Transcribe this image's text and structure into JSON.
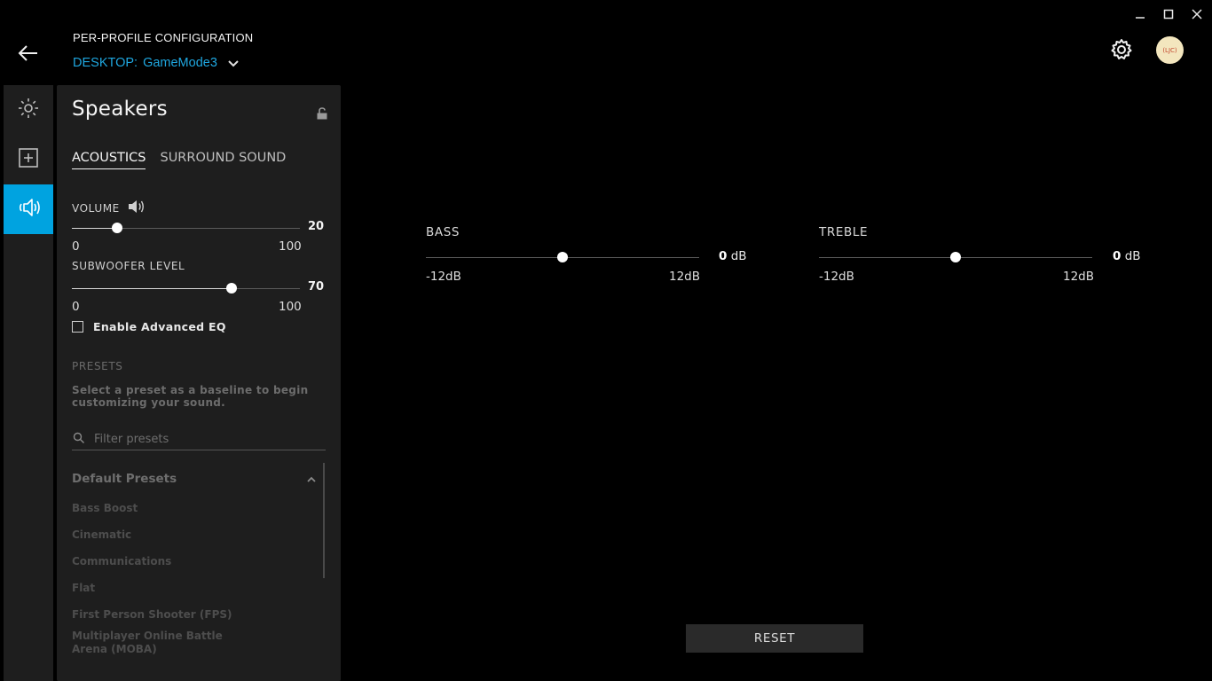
{
  "window": {
    "minimize_icon": "minimize-icon",
    "maximize_icon": "maximize-icon",
    "close_icon": "close-icon"
  },
  "header": {
    "title": "PER-PROFILE CONFIGURATION",
    "profile_prefix": "DESKTOP:",
    "profile_name": "GameMode3",
    "avatar_text": "(LJC)"
  },
  "colors": {
    "accent": "#00a3e0",
    "background": "#000000",
    "panel": "#1e1e1e"
  },
  "rail": {
    "items": [
      {
        "name": "lighting",
        "icon": "sun-icon",
        "active": false
      },
      {
        "name": "assignments",
        "icon": "plus-square-icon",
        "active": false
      },
      {
        "name": "audio",
        "icon": "speaker-icon",
        "active": true
      }
    ]
  },
  "panel": {
    "title": "Speakers",
    "tabs": [
      {
        "label": "ACOUSTICS",
        "active": true
      },
      {
        "label": "SURROUND SOUND",
        "active": false
      }
    ],
    "volume": {
      "label": "VOLUME",
      "value": "20",
      "min": "0",
      "max": "100",
      "fraction": 0.2
    },
    "subwoofer": {
      "label": "SUBWOOFER LEVEL",
      "value": "70",
      "min": "0",
      "max": "100",
      "fraction": 0.7
    },
    "advanced_eq": {
      "label": "Enable Advanced EQ",
      "checked": false
    },
    "presets": {
      "label": "PRESETS",
      "description": "Select a preset as a baseline to begin customizing your sound.",
      "search_placeholder": "Filter presets",
      "group_title": "Default Presets",
      "items": [
        "Bass Boost",
        "Cinematic",
        "Communications",
        "Flat",
        "First Person Shooter (FPS)",
        "Multiplayer Online Battle Arena (MOBA)"
      ]
    }
  },
  "eq": {
    "bass": {
      "label": "BASS",
      "value": "0",
      "unit": "dB",
      "min": "-12dB",
      "max": "12dB",
      "fraction": 0.5
    },
    "treble": {
      "label": "TREBLE",
      "value": "0",
      "unit": "dB",
      "min": "-12dB",
      "max": "12dB",
      "fraction": 0.5
    }
  },
  "reset_label": "RESET"
}
